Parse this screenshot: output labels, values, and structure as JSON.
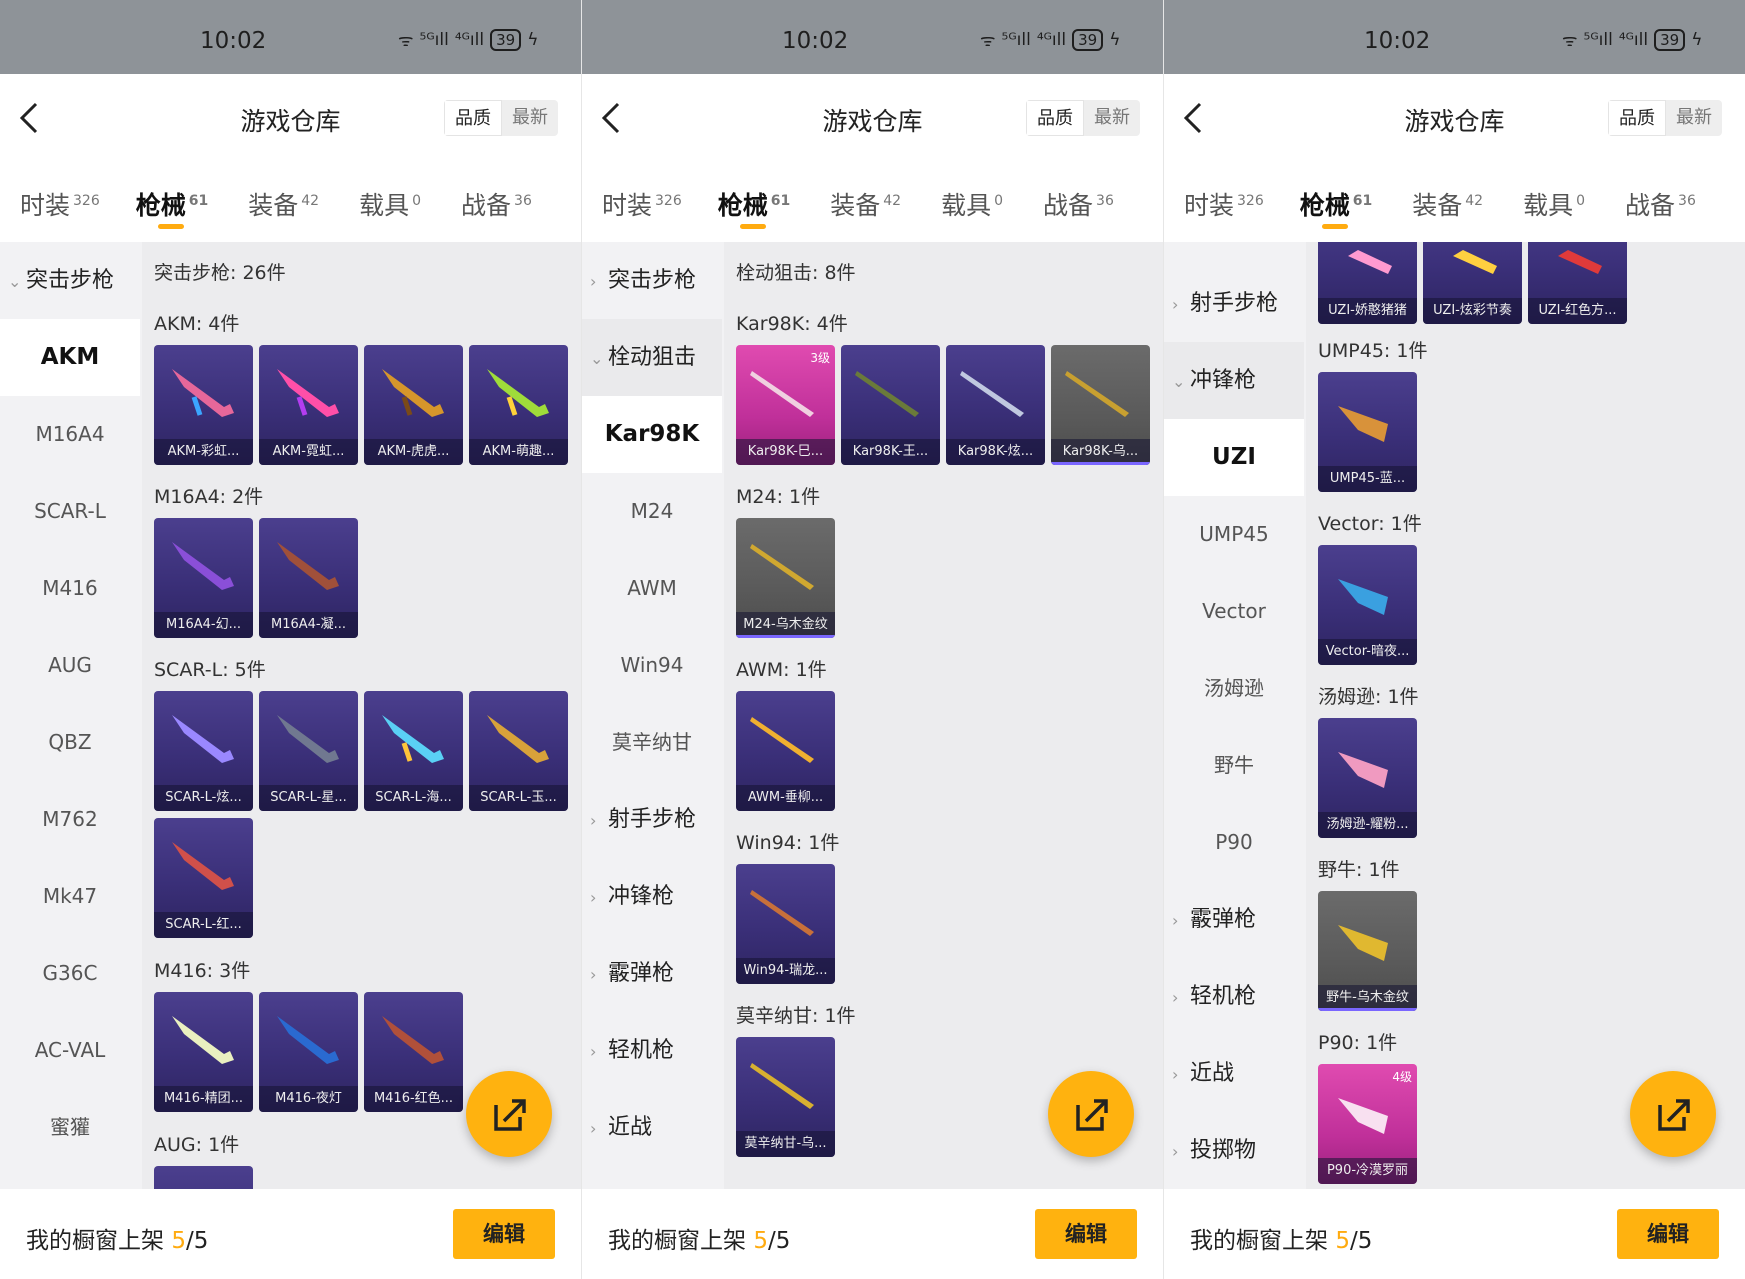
{
  "status": {
    "time": "10:02",
    "wifi": "ᯤ",
    "sig1": "⁵ᴳıll",
    "sig2": "⁴ᴳıll",
    "battery": "39",
    "charge": "ϟ"
  },
  "header": {
    "title": "游戏仓库",
    "sort_quality": "品质",
    "sort_latest": "最新"
  },
  "tabs": [
    {
      "label": "时装",
      "count": "326"
    },
    {
      "label": "枪械",
      "count": "61"
    },
    {
      "label": "装备",
      "count": "42"
    },
    {
      "label": "载具",
      "count": "0"
    },
    {
      "label": "战备",
      "count": "36"
    }
  ],
  "footer": {
    "label": "我的橱窗上架 ",
    "current": "5",
    "total": "/5",
    "edit": "编辑"
  },
  "panel1": {
    "side": {
      "group": "突击步枪",
      "items": [
        "AKM",
        "M16A4",
        "SCAR-L",
        "M416",
        "AUG",
        "QBZ",
        "M762",
        "Mk47",
        "G36C",
        "AC-VAL",
        "蜜獾"
      ]
    },
    "content": {
      "heading": "突击步枪: 26件",
      "s1": "AKM: 4件",
      "akm": [
        "AKM-彩虹...",
        "AKM-霓虹...",
        "AKM-虎虎...",
        "AKM-萌趣..."
      ],
      "s2": "M16A4: 2件",
      "m16": [
        "M16A4-幻...",
        "M16A4-凝..."
      ],
      "s3": "SCAR-L: 5件",
      "scar": [
        "SCAR-L-炫...",
        "SCAR-L-星...",
        "SCAR-L-海...",
        "SCAR-L-玉...",
        "SCAR-L-红..."
      ],
      "s4": "M416: 3件",
      "m416": [
        "M416-精团...",
        "M416-夜灯",
        "M416-红色..."
      ],
      "s5": "AUG: 1件"
    }
  },
  "panel2": {
    "side": {
      "g1": "突击步枪",
      "g2": "栓动狙击",
      "items": [
        "Kar98K",
        "M24",
        "AWM",
        "Win94",
        "莫辛纳甘"
      ],
      "g3": "射手步枪",
      "g4": "冲锋枪",
      "g5": "霰弹枪",
      "g6": "轻机枪",
      "g7": "近战"
    },
    "content": {
      "heading": "栓动狙击: 8件",
      "s1": "Kar98K: 4件",
      "kar": [
        "Kar98K-巳...",
        "Kar98K-王...",
        "Kar98K-炫...",
        "Kar98K-乌..."
      ],
      "kar_level": "3级",
      "s2": "M24: 1件",
      "m24": "M24-乌木金纹",
      "s3": "AWM: 1件",
      "awm": "AWM-垂柳...",
      "s4": "Win94: 1件",
      "win": "Win94-瑞龙...",
      "s5": "莫辛纳甘: 1件",
      "mosin": "莫辛纳甘-乌..."
    }
  },
  "panel3": {
    "side": {
      "g1": "射手步枪",
      "g2": "冲锋枪",
      "items": [
        "UZI",
        "UMP45",
        "Vector",
        "汤姆逊",
        "野牛",
        "P90"
      ],
      "g3": "霰弹枪",
      "g4": "轻机枪",
      "g5": "近战",
      "g6": "投掷物"
    },
    "content": {
      "uzi": [
        "UZI-娇憨猪猪",
        "UZI-炫彩节奏",
        "UZI-红色方..."
      ],
      "s1": "UMP45: 1件",
      "ump": "UMP45-蓝...",
      "s2": "Vector: 1件",
      "vector": "Vector-暗夜...",
      "s3": "汤姆逊: 1件",
      "tommy": "汤姆逊-耀粉...",
      "s4": "野牛: 1件",
      "bizon": "野牛-乌木金纹",
      "s5": "P90: 1件",
      "p90": "P90-冷漠罗丽",
      "p90_level": "4级"
    }
  }
}
